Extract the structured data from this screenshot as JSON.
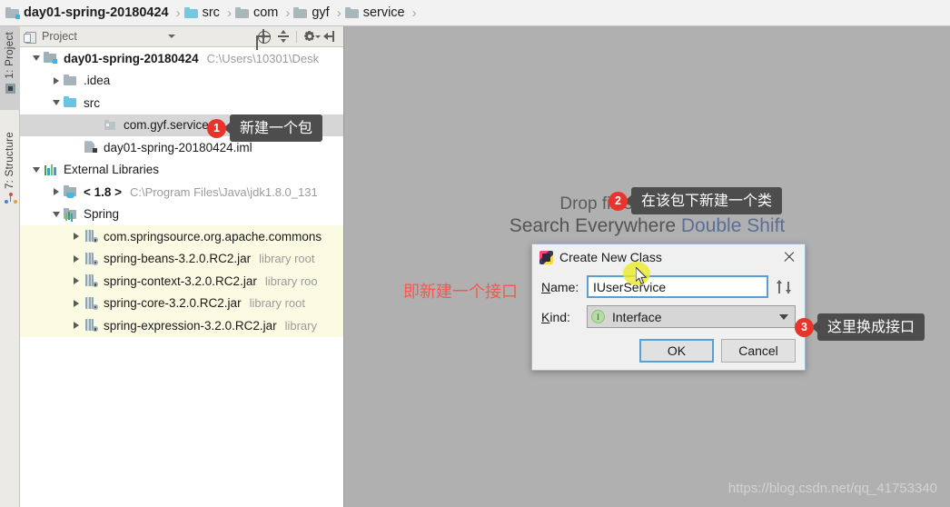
{
  "breadcrumb": {
    "items": [
      {
        "label": "day01-spring-20180424",
        "icon": "module-folder-icon",
        "bold": true
      },
      {
        "label": "src",
        "icon": "source-folder-icon",
        "bold": false
      },
      {
        "label": "com",
        "icon": "folder-icon",
        "bold": false
      },
      {
        "label": "gyf",
        "icon": "folder-icon",
        "bold": false
      },
      {
        "label": "service",
        "icon": "folder-icon",
        "bold": false
      }
    ],
    "separator": "›"
  },
  "tool_tabs": [
    {
      "label": "1: Project",
      "icon": "project-icon",
      "active": true
    },
    {
      "label": "7: Structure",
      "icon": "structure-icon",
      "active": false
    }
  ],
  "project_panel": {
    "title": "Project",
    "toolbar": {
      "locate": "locate-icon",
      "collapse_all": "collapse-all-icon",
      "settings": "gear-icon",
      "hide": "hide-panel-icon",
      "view_selector": "chevron-down-icon"
    },
    "tree": [
      {
        "label": "day01-spring-20180424",
        "path": "C:\\Users\\10301\\Desk",
        "icon": "module-icon",
        "indent": 0,
        "twisty": "open",
        "bold": true,
        "style": "plain"
      },
      {
        "label": ".idea",
        "path": "",
        "icon": "folder-icon",
        "indent": 1,
        "twisty": "closed",
        "bold": false,
        "style": "plain"
      },
      {
        "label": "src",
        "path": "",
        "icon": "source-folder-icon",
        "indent": 1,
        "twisty": "open",
        "bold": false,
        "style": "plain"
      },
      {
        "label": "com.gyf.service",
        "path": "",
        "icon": "package-icon",
        "indent": 2,
        "twisty": "none",
        "bold": false,
        "style": "selected"
      },
      {
        "label": "day01-spring-20180424.iml",
        "path": "",
        "icon": "iml-file-icon",
        "indent": 1,
        "twisty": "none",
        "bold": false,
        "style": "plain"
      },
      {
        "label": "External Libraries",
        "path": "",
        "icon": "external-libraries-icon",
        "indent": 0,
        "twisty": "open",
        "bold": false,
        "style": "plain"
      },
      {
        "label": "< 1.8 >",
        "path": "C:\\Program Files\\Java\\jdk1.8.0_131",
        "icon": "jdk-icon",
        "indent": 1,
        "twisty": "closed",
        "bold": true,
        "style": "plain"
      },
      {
        "label": "Spring",
        "path": "",
        "icon": "spring-library-icon",
        "indent": 1,
        "twisty": "open",
        "bold": false,
        "style": "plain"
      },
      {
        "label": "com.springsource.org.apache.commons",
        "path": "",
        "icon": "jar-icon",
        "indent": 2,
        "twisty": "closed",
        "bold": false,
        "style": "library"
      },
      {
        "label": "spring-beans-3.2.0.RC2.jar",
        "path": "library root",
        "icon": "jar-icon",
        "indent": 2,
        "twisty": "closed",
        "bold": false,
        "style": "library"
      },
      {
        "label": "spring-context-3.2.0.RC2.jar",
        "path": "library roo",
        "icon": "jar-icon",
        "indent": 2,
        "twisty": "closed",
        "bold": false,
        "style": "library"
      },
      {
        "label": "spring-core-3.2.0.RC2.jar",
        "path": "library root",
        "icon": "jar-icon",
        "indent": 2,
        "twisty": "closed",
        "bold": false,
        "style": "library"
      },
      {
        "label": "spring-expression-3.2.0.RC2.jar",
        "path": "library",
        "icon": "jar-icon",
        "indent": 2,
        "twisty": "closed",
        "bold": false,
        "style": "library"
      }
    ]
  },
  "editor": {
    "search_everywhere_label": "Search Everywhere",
    "search_everywhere_shortcut": "Double Shift",
    "drop_hint": "Drop files here to open",
    "watermark": "https://blog.csdn.net/qq_41753340"
  },
  "dialog": {
    "title": "Create New Class",
    "app_icon": "intellij-idea-icon",
    "close_icon": "close-icon",
    "name_label": "Name:",
    "name_value": "IUserService",
    "name_placeholder": "",
    "history_up_icon": "arrow-up-icon",
    "history_down_icon": "arrow-down-icon",
    "kind_label": "Kind:",
    "kind_value": "Interface",
    "kind_badge": "I",
    "kind_caret": "chevron-down-icon",
    "ok_label": "OK",
    "cancel_label": "Cancel"
  },
  "annotations": {
    "red_note": "即新建一个接口",
    "callouts": [
      {
        "number": "1",
        "text": "新建一个包"
      },
      {
        "number": "2",
        "text": "在该包下新建一个类"
      },
      {
        "number": "3",
        "text": "这里换成接口"
      }
    ]
  },
  "colors": {
    "accent_blue": "#5a9fd4",
    "callout_red": "#e8342a",
    "callout_bg": "#4d4d4d",
    "selection_gray": "#d6d6d6",
    "library_yellow": "#fbfbe4",
    "editor_bg": "#b0b0b0",
    "note_red": "#f4584f"
  }
}
